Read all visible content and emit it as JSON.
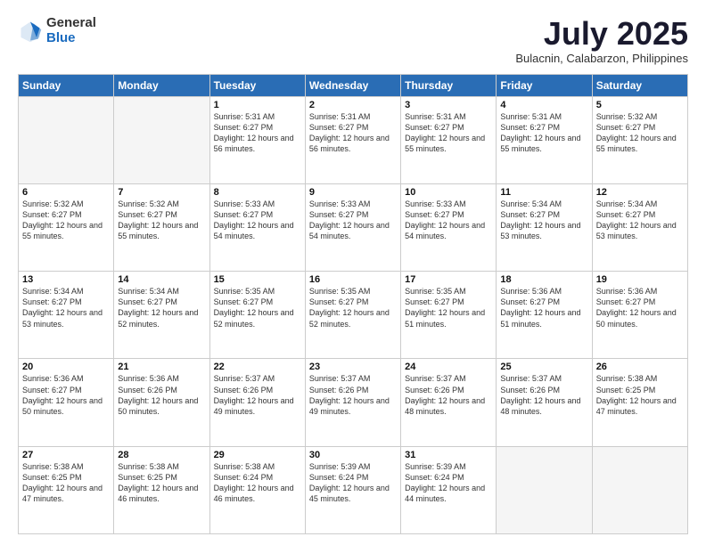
{
  "logo": {
    "general": "General",
    "blue": "Blue"
  },
  "title": "July 2025",
  "subtitle": "Bulacnin, Calabarzon, Philippines",
  "days_of_week": [
    "Sunday",
    "Monday",
    "Tuesday",
    "Wednesday",
    "Thursday",
    "Friday",
    "Saturday"
  ],
  "weeks": [
    [
      {
        "day": "",
        "info": ""
      },
      {
        "day": "",
        "info": ""
      },
      {
        "day": "1",
        "info": "Sunrise: 5:31 AM\nSunset: 6:27 PM\nDaylight: 12 hours and 56 minutes."
      },
      {
        "day": "2",
        "info": "Sunrise: 5:31 AM\nSunset: 6:27 PM\nDaylight: 12 hours and 56 minutes."
      },
      {
        "day": "3",
        "info": "Sunrise: 5:31 AM\nSunset: 6:27 PM\nDaylight: 12 hours and 55 minutes."
      },
      {
        "day": "4",
        "info": "Sunrise: 5:31 AM\nSunset: 6:27 PM\nDaylight: 12 hours and 55 minutes."
      },
      {
        "day": "5",
        "info": "Sunrise: 5:32 AM\nSunset: 6:27 PM\nDaylight: 12 hours and 55 minutes."
      }
    ],
    [
      {
        "day": "6",
        "info": "Sunrise: 5:32 AM\nSunset: 6:27 PM\nDaylight: 12 hours and 55 minutes."
      },
      {
        "day": "7",
        "info": "Sunrise: 5:32 AM\nSunset: 6:27 PM\nDaylight: 12 hours and 55 minutes."
      },
      {
        "day": "8",
        "info": "Sunrise: 5:33 AM\nSunset: 6:27 PM\nDaylight: 12 hours and 54 minutes."
      },
      {
        "day": "9",
        "info": "Sunrise: 5:33 AM\nSunset: 6:27 PM\nDaylight: 12 hours and 54 minutes."
      },
      {
        "day": "10",
        "info": "Sunrise: 5:33 AM\nSunset: 6:27 PM\nDaylight: 12 hours and 54 minutes."
      },
      {
        "day": "11",
        "info": "Sunrise: 5:34 AM\nSunset: 6:27 PM\nDaylight: 12 hours and 53 minutes."
      },
      {
        "day": "12",
        "info": "Sunrise: 5:34 AM\nSunset: 6:27 PM\nDaylight: 12 hours and 53 minutes."
      }
    ],
    [
      {
        "day": "13",
        "info": "Sunrise: 5:34 AM\nSunset: 6:27 PM\nDaylight: 12 hours and 53 minutes."
      },
      {
        "day": "14",
        "info": "Sunrise: 5:34 AM\nSunset: 6:27 PM\nDaylight: 12 hours and 52 minutes."
      },
      {
        "day": "15",
        "info": "Sunrise: 5:35 AM\nSunset: 6:27 PM\nDaylight: 12 hours and 52 minutes."
      },
      {
        "day": "16",
        "info": "Sunrise: 5:35 AM\nSunset: 6:27 PM\nDaylight: 12 hours and 52 minutes."
      },
      {
        "day": "17",
        "info": "Sunrise: 5:35 AM\nSunset: 6:27 PM\nDaylight: 12 hours and 51 minutes."
      },
      {
        "day": "18",
        "info": "Sunrise: 5:36 AM\nSunset: 6:27 PM\nDaylight: 12 hours and 51 minutes."
      },
      {
        "day": "19",
        "info": "Sunrise: 5:36 AM\nSunset: 6:27 PM\nDaylight: 12 hours and 50 minutes."
      }
    ],
    [
      {
        "day": "20",
        "info": "Sunrise: 5:36 AM\nSunset: 6:27 PM\nDaylight: 12 hours and 50 minutes."
      },
      {
        "day": "21",
        "info": "Sunrise: 5:36 AM\nSunset: 6:26 PM\nDaylight: 12 hours and 50 minutes."
      },
      {
        "day": "22",
        "info": "Sunrise: 5:37 AM\nSunset: 6:26 PM\nDaylight: 12 hours and 49 minutes."
      },
      {
        "day": "23",
        "info": "Sunrise: 5:37 AM\nSunset: 6:26 PM\nDaylight: 12 hours and 49 minutes."
      },
      {
        "day": "24",
        "info": "Sunrise: 5:37 AM\nSunset: 6:26 PM\nDaylight: 12 hours and 48 minutes."
      },
      {
        "day": "25",
        "info": "Sunrise: 5:37 AM\nSunset: 6:26 PM\nDaylight: 12 hours and 48 minutes."
      },
      {
        "day": "26",
        "info": "Sunrise: 5:38 AM\nSunset: 6:25 PM\nDaylight: 12 hours and 47 minutes."
      }
    ],
    [
      {
        "day": "27",
        "info": "Sunrise: 5:38 AM\nSunset: 6:25 PM\nDaylight: 12 hours and 47 minutes."
      },
      {
        "day": "28",
        "info": "Sunrise: 5:38 AM\nSunset: 6:25 PM\nDaylight: 12 hours and 46 minutes."
      },
      {
        "day": "29",
        "info": "Sunrise: 5:38 AM\nSunset: 6:24 PM\nDaylight: 12 hours and 46 minutes."
      },
      {
        "day": "30",
        "info": "Sunrise: 5:39 AM\nSunset: 6:24 PM\nDaylight: 12 hours and 45 minutes."
      },
      {
        "day": "31",
        "info": "Sunrise: 5:39 AM\nSunset: 6:24 PM\nDaylight: 12 hours and 44 minutes."
      },
      {
        "day": "",
        "info": ""
      },
      {
        "day": "",
        "info": ""
      }
    ]
  ]
}
